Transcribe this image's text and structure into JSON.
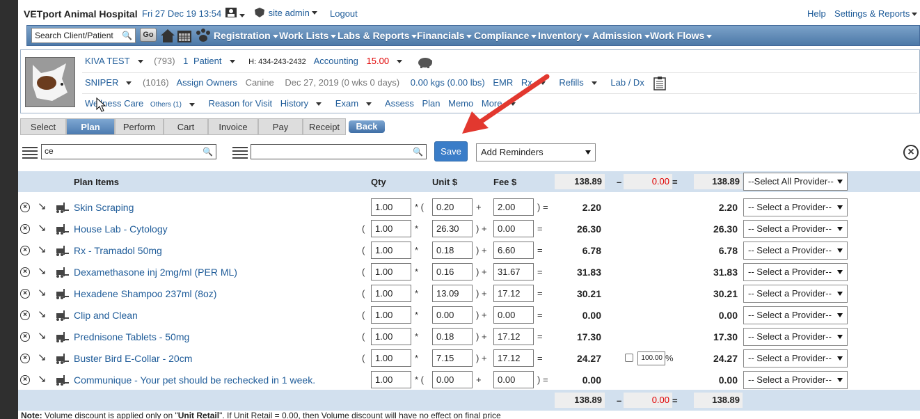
{
  "topbar": {
    "hospital": "VETport Animal Hospital",
    "datetime": "Fri 27 Dec 19 13:54",
    "user": "site admin",
    "logout": "Logout",
    "help": "Help",
    "settings": "Settings & Reports"
  },
  "nav": {
    "search_value": "Search Client/Patient",
    "go": "Go",
    "items": [
      "Registration",
      "Work Lists",
      "Labs & Reports",
      "Financials",
      "Compliance",
      "Inventory",
      "Admission",
      "Work Flows"
    ]
  },
  "patient": {
    "client_name": "KIVA TEST",
    "client_id": "(793)",
    "patient_count": "1",
    "patient_label": "Patient",
    "phone": "H: 434-243-2432",
    "accounting": "Accounting",
    "accounting_amount": "15.00",
    "pet_name": "SNIPER",
    "pet_id": "(1016)",
    "assign_owners": "Assign Owners",
    "species": "Canine",
    "dob": "Dec 27, 2019 (0 wks 0 days)",
    "weight": "0.00 kgs (0.00 lbs)",
    "emr": "EMR",
    "rx": "Rx",
    "refills": "Refills",
    "lab_dx": "Lab / Dx",
    "links": [
      "Wellness Care",
      "Reason for Visit",
      "History",
      "Exam",
      "Assess",
      "Plan",
      "Memo",
      "More"
    ],
    "others": "Others (1)"
  },
  "workflow": {
    "steps": [
      "Select",
      "Plan",
      "Perform",
      "Cart",
      "Invoice",
      "Pay",
      "Receipt"
    ],
    "active": "Plan",
    "back": "Back"
  },
  "controls": {
    "search_left": "ce",
    "search_right": "",
    "save": "Save",
    "reminders": "Add Reminders"
  },
  "table": {
    "headers": {
      "items": "Plan Items",
      "qty": "Qty",
      "unit": "Unit $",
      "fee": "Fee $"
    },
    "header_total": "138.89",
    "header_discount": "0.00",
    "header_grand": "138.89",
    "select_all_provider": "--Select All Provider--",
    "rows": [
      {
        "name": "Skin Scraping",
        "open": "",
        "qty": "1.00",
        "op": "* (",
        "unit": "0.20",
        "plus": "+",
        "fee": "2.00",
        "close": ") =",
        "total": "2.20",
        "final": "2.20",
        "provider": "-- Select a Provider--"
      },
      {
        "name": "House Lab - Cytology",
        "open": "(",
        "qty": "1.00",
        "op": "*",
        "unit": "26.30",
        "plus": ") +",
        "fee": "0.00",
        "close": "=",
        "total": "26.30",
        "final": "26.30",
        "provider": "-- Select a Provider--"
      },
      {
        "name": "Rx - Tramadol 50mg",
        "open": "(",
        "qty": "1.00",
        "op": "*",
        "unit": "0.18",
        "plus": ") +",
        "fee": "6.60",
        "close": "=",
        "total": "6.78",
        "final": "6.78",
        "provider": "-- Select a Provider--"
      },
      {
        "name": "Dexamethasone inj 2mg/ml (PER ML)",
        "open": "(",
        "qty": "1.00",
        "op": "*",
        "unit": "0.16",
        "plus": ") +",
        "fee": "31.67",
        "close": "=",
        "total": "31.83",
        "final": "31.83",
        "provider": "-- Select a Provider--"
      },
      {
        "name": "Hexadene Shampoo 237ml (8oz)",
        "open": "(",
        "qty": "1.00",
        "op": "*",
        "unit": "13.09",
        "plus": ") +",
        "fee": "17.12",
        "close": "=",
        "total": "30.21",
        "final": "30.21",
        "provider": "-- Select a Provider--"
      },
      {
        "name": "Clip and Clean",
        "open": "(",
        "qty": "1.00",
        "op": "*",
        "unit": "0.00",
        "plus": ") +",
        "fee": "0.00",
        "close": "=",
        "total": "0.00",
        "final": "0.00",
        "provider": "-- Select a Provider--"
      },
      {
        "name": "Prednisone Tablets - 50mg",
        "open": "(",
        "qty": "1.00",
        "op": "*",
        "unit": "0.18",
        "plus": ") +",
        "fee": "17.12",
        "close": "=",
        "total": "17.30",
        "final": "17.30",
        "provider": "-- Select a Provider--"
      },
      {
        "name": "Buster Bird E-Collar - 20cm",
        "open": "(",
        "qty": "1.00",
        "op": "*",
        "unit": "7.15",
        "plus": ") +",
        "fee": "17.12",
        "close": "=",
        "total": "24.27",
        "final": "24.27",
        "provider": "-- Select a Provider--",
        "discount_pct": "100.00",
        "pct": "%"
      },
      {
        "name": "Communique - Your pet should be rechecked in 1 week.",
        "open": "",
        "qty": "1.00",
        "op": "* (",
        "unit": "0.00",
        "plus": "+",
        "fee": "0.00",
        "close": ") =",
        "total": "0.00",
        "final": "0.00",
        "provider": "-- Select a Provider--"
      }
    ],
    "footer_total": "138.89",
    "footer_discount": "0.00",
    "footer_grand": "138.89",
    "minus": "–",
    "equals": "="
  },
  "note": {
    "label": "Note:",
    "text_a": " Volume discount is applied only on \"",
    "bold": "Unit Retail",
    "text_b": "\". If Unit Retail = 0.00, then Volume discount will have no effect on final price"
  },
  "colors": {
    "accent": "#4d79a8",
    "link": "#1f5c99",
    "red": "#e00000",
    "save": "#3a7dc8"
  }
}
